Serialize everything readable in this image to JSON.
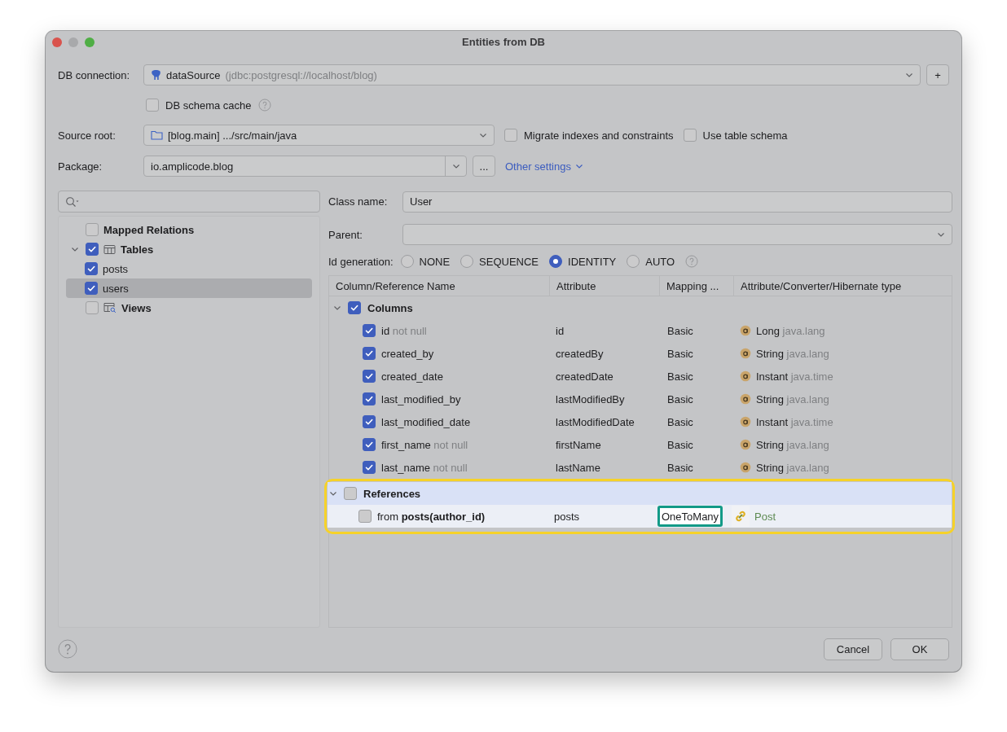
{
  "window": {
    "title": "Entities from DB"
  },
  "db_connection": {
    "label": "DB connection:",
    "value": "dataSource",
    "detail": "(jdbc:postgresql://localhost/blog)",
    "add_button": "+"
  },
  "schema_cache": {
    "label": "DB schema cache",
    "checked": false
  },
  "source_root": {
    "label": "Source root:",
    "value": "[blog.main] .../src/main/java"
  },
  "options": [
    {
      "label": "Migrate indexes and constraints",
      "checked": false
    },
    {
      "label": "Use table schema",
      "checked": false
    }
  ],
  "package": {
    "label": "Package:",
    "value": "io.amplicode.blog",
    "browse_button": "...",
    "other_settings": "Other settings"
  },
  "tree": [
    {
      "kind": "relations",
      "label": "Mapped Relations",
      "checked": false,
      "selected": false
    },
    {
      "kind": "tables",
      "label": "Tables",
      "checked": true,
      "selected": false,
      "expanded": true,
      "children": [
        {
          "label": "posts",
          "checked": true,
          "selected": false
        },
        {
          "label": "users",
          "checked": true,
          "selected": true
        }
      ]
    },
    {
      "kind": "views",
      "label": "Views",
      "checked": false,
      "selected": false
    }
  ],
  "class_name": {
    "label": "Class name:",
    "value": "User"
  },
  "parent": {
    "label": "Parent:"
  },
  "id_generation": {
    "label": "Id generation:",
    "options": [
      {
        "label": "NONE",
        "selected": false
      },
      {
        "label": "SEQUENCE",
        "selected": false
      },
      {
        "label": "IDENTITY",
        "selected": true
      },
      {
        "label": "AUTO",
        "selected": false
      }
    ]
  },
  "table": {
    "columns": [
      "Column/Reference Name",
      "Attribute",
      "Mapping ...",
      "Attribute/Converter/Hibernate type"
    ],
    "sections": [
      {
        "name": "Columns",
        "checked": true,
        "expanded": true,
        "highlighted": false,
        "rows": [
          {
            "kind": "column",
            "name": "id",
            "note": "not null",
            "attribute": "id",
            "mapping": "Basic",
            "mapping_focused": false,
            "type": "Long",
            "package": "java.lang",
            "checked": true
          },
          {
            "kind": "column",
            "name": "created_by",
            "attribute": "createdBy",
            "mapping": "Basic",
            "mapping_focused": false,
            "type": "String",
            "package": "java.lang",
            "checked": true
          },
          {
            "kind": "column",
            "name": "created_date",
            "attribute": "createdDate",
            "mapping": "Basic",
            "mapping_focused": false,
            "type": "Instant",
            "package": "java.time",
            "checked": true
          },
          {
            "kind": "column",
            "name": "last_modified_by",
            "attribute": "lastModifiedBy",
            "mapping": "Basic",
            "mapping_focused": false,
            "type": "String",
            "package": "java.lang",
            "checked": true
          },
          {
            "kind": "column",
            "name": "last_modified_date",
            "attribute": "lastModifiedDate",
            "mapping": "Basic",
            "mapping_focused": false,
            "type": "Instant",
            "package": "java.time",
            "checked": true
          },
          {
            "kind": "column",
            "name": "first_name",
            "note": "not null",
            "attribute": "firstName",
            "mapping": "Basic",
            "mapping_focused": false,
            "type": "String",
            "package": "java.lang",
            "checked": true
          },
          {
            "kind": "column",
            "name": "last_name",
            "note": "not null",
            "attribute": "lastName",
            "mapping": "Basic",
            "mapping_focused": false,
            "type": "String",
            "package": "java.lang",
            "checked": true
          }
        ]
      },
      {
        "name": "References",
        "checked": false,
        "expanded": true,
        "highlighted": true,
        "rows": [
          {
            "kind": "reference",
            "name": "from **posts(author_id)**",
            "attribute": "posts",
            "mapping": "OneToMany",
            "mapping_focused": true,
            "type": "Post",
            "checked": false
          }
        ]
      }
    ]
  },
  "buttons": [
    {
      "label": "Cancel",
      "default": false
    },
    {
      "label": "OK",
      "default": false
    }
  ]
}
